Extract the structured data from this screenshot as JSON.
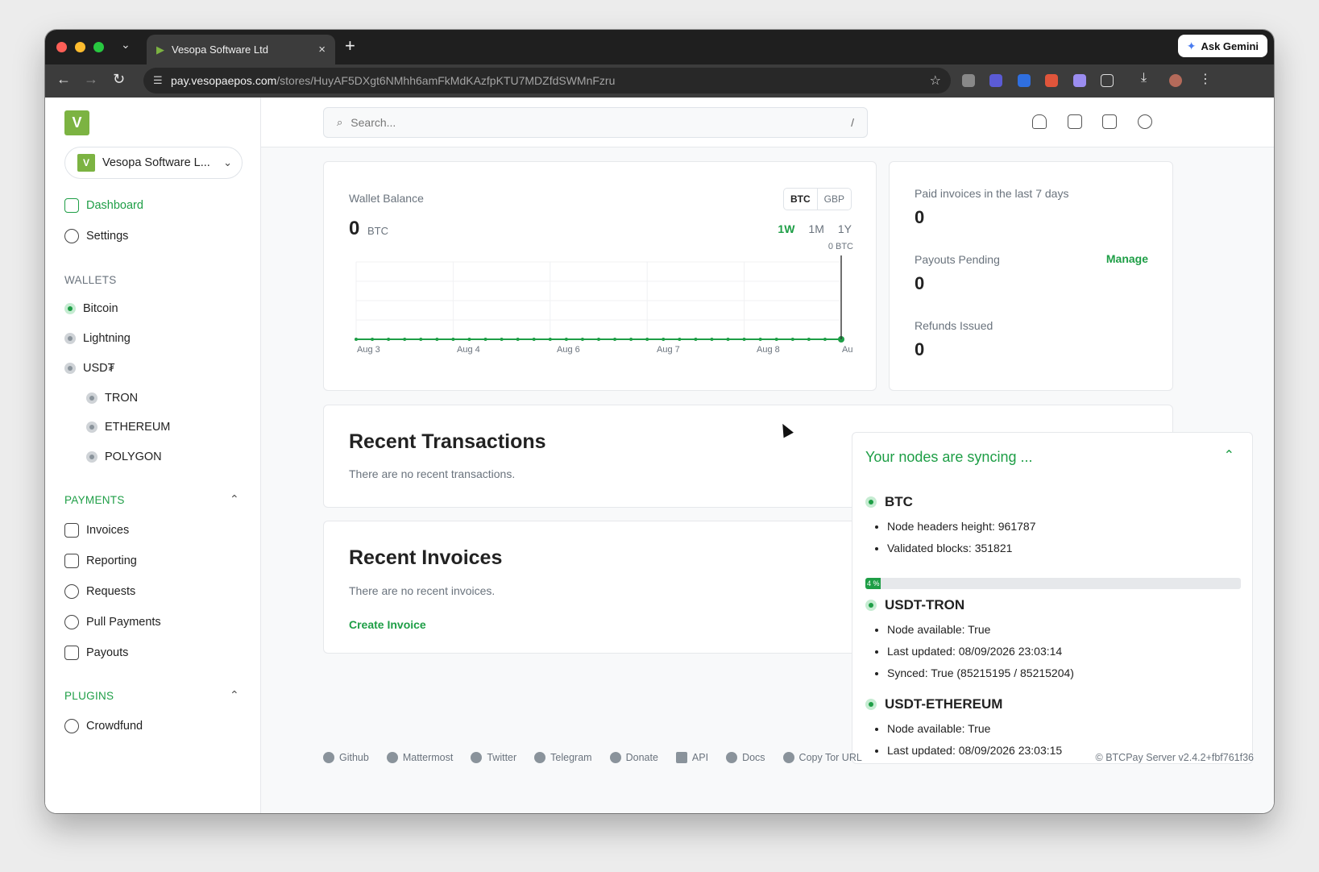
{
  "browser": {
    "tab_title": "Vesopa Software Ltd",
    "tab_close": "×",
    "new_tab": "+",
    "tab_dropdown": "⌄",
    "gemini_label": "Ask Gemini",
    "url_host": "pay.vesopaepos.com",
    "url_path": "/stores/HuyAF5DXgt6NMhh6amFkMdKAzfpKTU7MDZfdSWMnFzru"
  },
  "sidebar": {
    "logo_letter": "V",
    "store_name": "Vesopa Software L...",
    "nav": [
      {
        "label": "Dashboard",
        "icon": "dashboard-icon",
        "active": true
      },
      {
        "label": "Settings",
        "icon": "gear-icon",
        "active": false
      }
    ],
    "wallets_label": "WALLETS",
    "wallets": [
      {
        "label": "Bitcoin",
        "status": "on"
      },
      {
        "label": "Lightning",
        "status": "off"
      },
      {
        "label": "USD₮",
        "status": "off"
      }
    ],
    "sub_wallets": [
      {
        "label": "TRON"
      },
      {
        "label": "ETHEREUM"
      },
      {
        "label": "POLYGON"
      }
    ],
    "payments_label": "PAYMENTS",
    "payments": [
      {
        "label": "Invoices",
        "icon": "invoice-icon"
      },
      {
        "label": "Reporting",
        "icon": "reporting-icon"
      },
      {
        "label": "Requests",
        "icon": "requests-icon"
      },
      {
        "label": "Pull Payments",
        "icon": "pull-payments-icon"
      },
      {
        "label": "Payouts",
        "icon": "payouts-icon"
      }
    ],
    "plugins_label": "PLUGINS",
    "plugins": [
      {
        "label": "Crowdfund",
        "icon": "crowdfund-icon"
      }
    ]
  },
  "header": {
    "search_placeholder": "Search...",
    "search_shortcut": "/"
  },
  "wallet": {
    "title": "Wallet Balance",
    "amount": "0",
    "unit": "BTC",
    "currencies": [
      "BTC",
      "GBP"
    ],
    "selected_currency": "BTC",
    "ranges": [
      "1W",
      "1M",
      "1Y"
    ],
    "selected_range": "1W"
  },
  "chart_data": {
    "type": "line",
    "x_tick_labels": [
      "Aug 3",
      "Aug 4",
      "Aug 6",
      "Aug 7",
      "Aug 8",
      "Au"
    ],
    "y_tick_label": "0 BTC",
    "values": [
      0,
      0,
      0,
      0,
      0,
      0,
      0,
      0,
      0,
      0,
      0,
      0,
      0,
      0,
      0,
      0,
      0,
      0,
      0,
      0,
      0,
      0,
      0,
      0,
      0,
      0,
      0,
      0,
      0,
      0,
      0
    ],
    "line_color": "#1e9e46",
    "grid": true
  },
  "stats": {
    "paid_label": "Paid invoices in the last 7 days",
    "paid_value": "0",
    "payouts_label": "Payouts Pending",
    "payouts_value": "0",
    "manage_label": "Manage",
    "refunds_label": "Refunds Issued",
    "refunds_value": "0"
  },
  "recent_transactions": {
    "title": "Recent Transactions",
    "empty": "There are no recent transactions."
  },
  "recent_invoices": {
    "title": "Recent Invoices",
    "empty": "There are no recent invoices.",
    "create_label": "Create Invoice"
  },
  "sync": {
    "title": "Your nodes are syncing ...",
    "progress_percent": 4,
    "progress_label": "4 %",
    "nodes": [
      {
        "name": "BTC",
        "lines": [
          "Node headers height: 961787",
          "Validated blocks: 351821"
        ]
      },
      {
        "name": "USDT-TRON",
        "lines": [
          "Node available: True",
          "Last updated: 08/09/2026 23:03:14",
          "Synced: True (85215195 / 85215204)"
        ]
      },
      {
        "name": "USDT-ETHEREUM",
        "lines": [
          "Node available: True",
          "Last updated: 08/09/2026 23:03:15"
        ]
      }
    ]
  },
  "footer": {
    "links": [
      "Github",
      "Mattermost",
      "Twitter",
      "Telegram",
      "Donate",
      "API",
      "Docs",
      "Copy Tor URL"
    ],
    "copyright": "© BTCPay Server v2.4.2+fbf761f36"
  },
  "colors": {
    "accent": "#1e9e46",
    "brand": "#7cb342"
  }
}
